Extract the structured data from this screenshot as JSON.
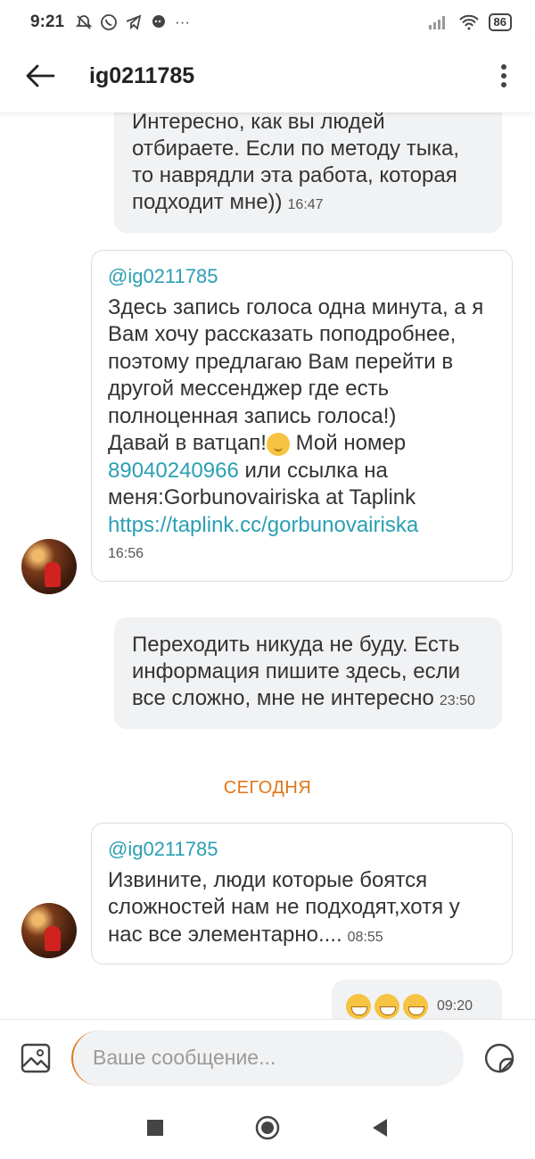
{
  "status_bar": {
    "time": "9:21",
    "notifications": [
      "muted-notifications-icon",
      "whatsapp-icon",
      "telegram-icon",
      "chat-icon"
    ],
    "more": "···",
    "battery": "86"
  },
  "header": {
    "title": "ig0211785"
  },
  "messages": [
    {
      "type": "outgoing",
      "text": "Интересно, как вы людей отбираете. Если по методу тыка, то наврядли эта работа, которая подходит мне))",
      "time": "16:47"
    },
    {
      "type": "incoming",
      "mention": "@ig0211785",
      "text_1": "Здесь запись голоса одна минута, а я Вам хочу рассказать поподробнее, поэтому предлагаю Вам перейти в другой мессенджер где есть полноценная запись голоса!)",
      "text_2": "Давай  в ватцап!",
      "text_3": " Мой номер",
      "phone": "89040240966",
      "text_4": " или ссылка на меня:Gorbunovairiska at Taplink",
      "link": "https://taplink.cc/gorbunovairiska",
      "time": "16:56"
    },
    {
      "type": "outgoing",
      "text": "Переходить никуда не буду. Есть информация пишите здесь, если все сложно, мне не интересно",
      "time": "23:50"
    },
    {
      "type": "date",
      "text": "СЕГОДНЯ"
    },
    {
      "type": "incoming",
      "mention": "@ig0211785",
      "text": "Извините, люди которые боятся сложностей нам не подходят,хотя у нас все элементарно....",
      "time": "08:55"
    },
    {
      "type": "outgoing",
      "emoji_count": 3,
      "time": "09:20"
    }
  ],
  "input": {
    "placeholder": "Ваше сообщение..."
  },
  "colors": {
    "accent_link": "#2a9fb3",
    "date_separator": "#e2761b",
    "outgoing_bubble": "#f1f2f4"
  }
}
